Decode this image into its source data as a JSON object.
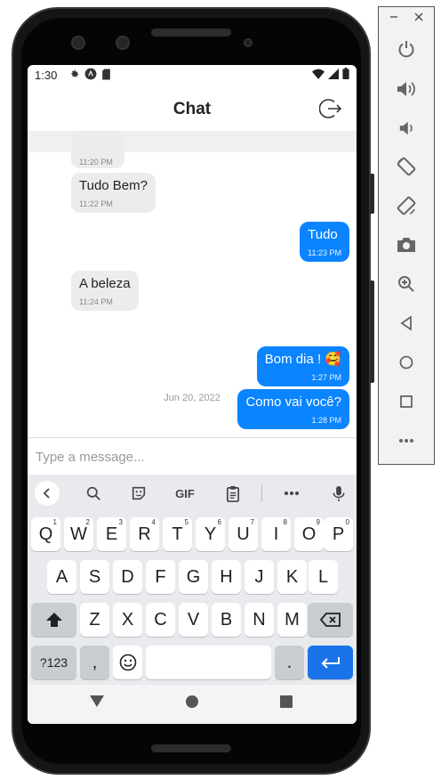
{
  "status_bar": {
    "time": "1:30"
  },
  "header": {
    "title": "Chat"
  },
  "messages": [
    {
      "direction": "received",
      "text": "",
      "time": "11:20 PM"
    },
    {
      "direction": "received",
      "text": "Tudo Bem?",
      "time": "11:22 PM"
    },
    {
      "direction": "sent",
      "text": "Tudo",
      "time": "11:23 PM"
    },
    {
      "direction": "received",
      "text": "A beleza",
      "time": "11:24 PM"
    },
    {
      "direction": "sent",
      "text": "Bom dia ! 🥰",
      "time": "1:27 PM"
    },
    {
      "direction": "sent",
      "text": "Como vai você?",
      "time": "1:28 PM"
    }
  ],
  "date_separator": "Jun 20, 2022",
  "composer": {
    "placeholder": "Type a message..."
  },
  "keyboard": {
    "toolbar": {
      "gif_label": "GIF"
    },
    "row1": [
      {
        "label": "Q",
        "hint": "1"
      },
      {
        "label": "W",
        "hint": "2"
      },
      {
        "label": "E",
        "hint": "3"
      },
      {
        "label": "R",
        "hint": "4"
      },
      {
        "label": "T",
        "hint": "5"
      },
      {
        "label": "Y",
        "hint": "6"
      },
      {
        "label": "U",
        "hint": "7"
      },
      {
        "label": "I",
        "hint": "8"
      },
      {
        "label": "O",
        "hint": "9"
      },
      {
        "label": "P",
        "hint": "0"
      }
    ],
    "row2": [
      "A",
      "S",
      "D",
      "F",
      "G",
      "H",
      "J",
      "K",
      "L"
    ],
    "row3": [
      "Z",
      "X",
      "C",
      "V",
      "B",
      "N",
      "M"
    ],
    "row4": {
      "symbols": "?123",
      "comma": ",",
      "period": "."
    }
  },
  "icons": {
    "status_left": [
      "gear-icon",
      "android-icon",
      "sd-card-icon"
    ],
    "status_right": [
      "wifi-icon",
      "signal-icon",
      "battery-icon"
    ],
    "header": "logout-icon",
    "keyboard_toolbar": [
      "chevron-left-icon",
      "search-icon",
      "sticker-icon",
      "clipboard-icon",
      "more-icon",
      "mic-icon"
    ],
    "emulator_panel": [
      "power-icon",
      "volume-up-icon",
      "volume-down-icon",
      "rotate-left-icon",
      "rotate-right-icon",
      "camera-icon",
      "zoom-icon",
      "back-icon",
      "home-icon",
      "overview-icon",
      "more-icon"
    ]
  },
  "colors": {
    "sent_bubble": "#0a84ff",
    "received_bubble": "#ececec",
    "keyboard_bg": "#e8eaed",
    "enter_key": "#1a73e8"
  }
}
